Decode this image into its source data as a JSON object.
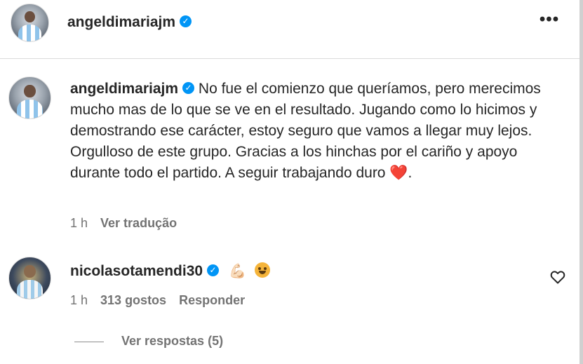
{
  "header": {
    "username": "angeldimariajm"
  },
  "post": {
    "username": "angeldimariajm",
    "caption": "No fue el comienzo que queríamos, pero merecimos mucho mas de lo que se ve en el resultado. Jugando como lo hicimos y demostrando ese carácter, estoy seguro que vamos a llegar muy lejos. Orgulloso de este grupo. Gracias a los hinchas por el cariño y apoyo durante todo el partido. A seguir trabajando duro",
    "caption_end_emoji": "❤️",
    "caption_suffix": ".",
    "time": "1 h",
    "translate_label": "Ver tradução"
  },
  "comment": {
    "username": "nicolasotamendi30",
    "emojis": [
      "💪🏻",
      "🤠"
    ],
    "time": "1 h",
    "likes": "313 gostos",
    "reply_label": "Responder",
    "view_replies_label": "Ver respostas (5)"
  },
  "icons": {
    "more": "more-options-icon",
    "verified": "verified-badge-icon",
    "like": "heart-outline-icon"
  },
  "colors": {
    "verified": "#0095f6",
    "secondary_text": "#737373",
    "heart": "#e0245e"
  }
}
